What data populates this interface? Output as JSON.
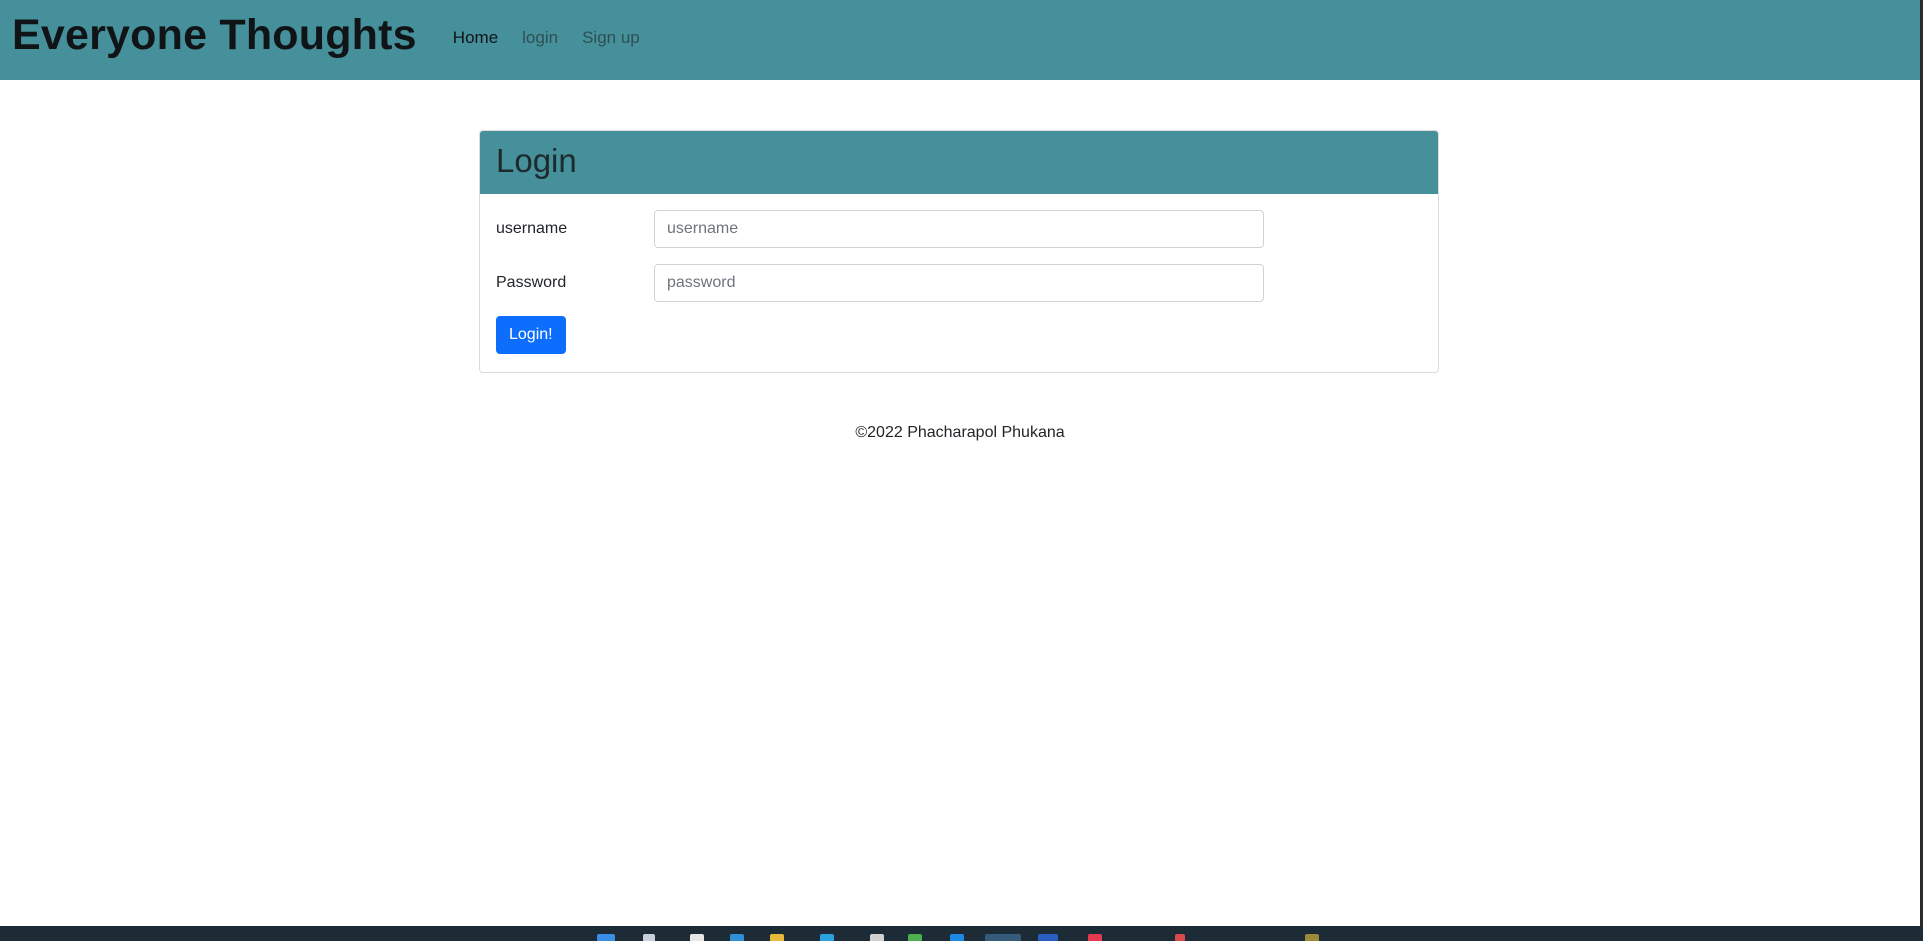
{
  "navbar": {
    "brand": "Everyone Thoughts",
    "links": [
      {
        "label": "Home"
      },
      {
        "label": "login"
      },
      {
        "label": "Sign up"
      }
    ]
  },
  "login_card": {
    "title": "Login",
    "username": {
      "label": "username",
      "placeholder": "username",
      "value": ""
    },
    "password": {
      "label": "Password",
      "placeholder": "password",
      "value": ""
    },
    "submit_label": "Login!"
  },
  "footer": {
    "text": "©2022 Phacharapol Phukana"
  },
  "colors": {
    "primary_header": "#45909a",
    "button": "#0d6efd",
    "taskbar": "#1c2b36"
  },
  "taskbar": {
    "icons": [
      "windows-start-icon",
      "search-icon",
      "task-view-icon",
      "edge-icon",
      "file-explorer-icon",
      "store-icon",
      "mail-icon",
      "chrome-icon",
      "vscode-icon",
      "browser-icon",
      "word-icon",
      "app-icon",
      "app-icon",
      "app-icon"
    ]
  }
}
